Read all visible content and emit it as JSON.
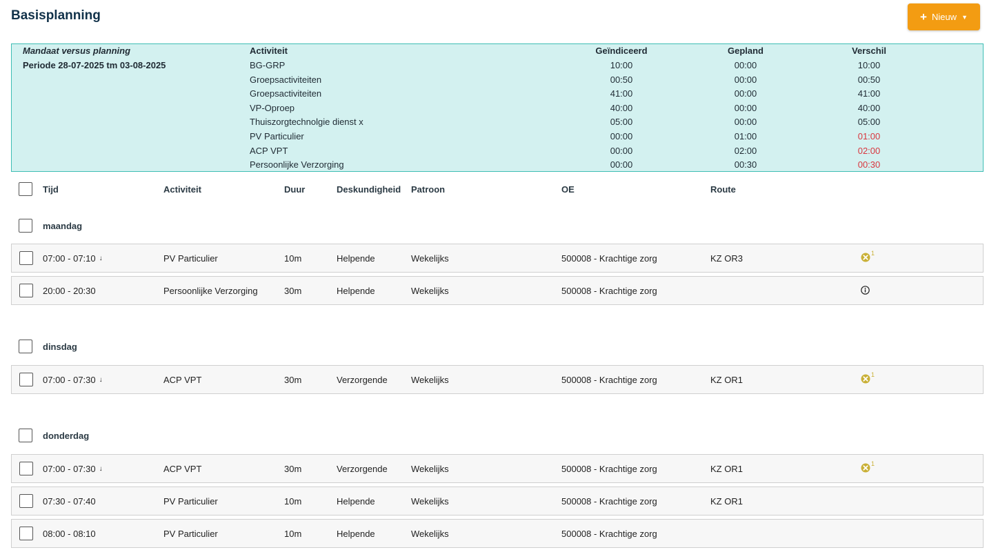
{
  "page": {
    "title": "Basisplanning"
  },
  "new_button": {
    "label": "Nieuw",
    "icon": "plus-icon",
    "caret": "caret-down-icon"
  },
  "summary": {
    "title": "Mandaat versus planning",
    "period": "Periode 28-07-2025 tm 03-08-2025",
    "headers": {
      "activity": "Activiteit",
      "indicated": "Geïndiceerd",
      "planned": "Gepland",
      "difference": "Verschil"
    },
    "rows": [
      {
        "activity": "BG-GRP",
        "indicated": "10:00",
        "planned": "00:00",
        "difference": "10:00",
        "negative": false
      },
      {
        "activity": "Groepsactiviteiten",
        "indicated": "00:50",
        "planned": "00:00",
        "difference": "00:50",
        "negative": false
      },
      {
        "activity": "Groepsactiviteiten",
        "indicated": "41:00",
        "planned": "00:00",
        "difference": "41:00",
        "negative": false
      },
      {
        "activity": "VP-Oproep",
        "indicated": "40:00",
        "planned": "00:00",
        "difference": "40:00",
        "negative": false
      },
      {
        "activity": "Thuiszorgtechnolgie dienst x",
        "indicated": "05:00",
        "planned": "00:00",
        "difference": "05:00",
        "negative": false
      },
      {
        "activity": "PV Particulier",
        "indicated": "00:00",
        "planned": "01:00",
        "difference": "01:00",
        "negative": true
      },
      {
        "activity": "ACP VPT",
        "indicated": "00:00",
        "planned": "02:00",
        "difference": "02:00",
        "negative": true
      },
      {
        "activity": "Persoonlijke Verzorging",
        "indicated": "00:00",
        "planned": "00:30",
        "difference": "00:30",
        "negative": true
      }
    ]
  },
  "table": {
    "headers": {
      "time": "Tijd",
      "activity": "Activiteit",
      "duration": "Duur",
      "expertise": "Deskundigheid",
      "pattern": "Patroon",
      "oe": "OE",
      "route": "Route"
    }
  },
  "days": [
    {
      "label": "maandag",
      "rows": [
        {
          "time": "07:00 - 07:10",
          "has_arrow": true,
          "activity": "PV Particulier",
          "duration": "10m",
          "expertise": "Helpende",
          "pattern": "Wekelijks",
          "oe": "500008 - Krachtige zorg",
          "route": "KZ OR3",
          "status": "warning",
          "status_count": "1"
        },
        {
          "time": "20:00 - 20:30",
          "has_arrow": false,
          "activity": "Persoonlijke Verzorging",
          "duration": "30m",
          "expertise": "Helpende",
          "pattern": "Wekelijks",
          "oe": "500008 - Krachtige zorg",
          "route": "",
          "status": "info",
          "status_count": ""
        }
      ]
    },
    {
      "label": "dinsdag",
      "rows": [
        {
          "time": "07:00 - 07:30",
          "has_arrow": true,
          "activity": "ACP VPT",
          "duration": "30m",
          "expertise": "Verzorgende",
          "pattern": "Wekelijks",
          "oe": "500008 - Krachtige zorg",
          "route": "KZ OR1",
          "status": "warning",
          "status_count": "1"
        }
      ]
    },
    {
      "label": "donderdag",
      "rows": [
        {
          "time": "07:00 - 07:30",
          "has_arrow": true,
          "activity": "ACP VPT",
          "duration": "30m",
          "expertise": "Verzorgende",
          "pattern": "Wekelijks",
          "oe": "500008 - Krachtige zorg",
          "route": "KZ OR1",
          "status": "warning",
          "status_count": "1"
        },
        {
          "time": "07:30 - 07:40",
          "has_arrow": false,
          "activity": "PV Particulier",
          "duration": "10m",
          "expertise": "Helpende",
          "pattern": "Wekelijks",
          "oe": "500008 - Krachtige zorg",
          "route": "KZ OR1",
          "status": "",
          "status_count": ""
        },
        {
          "time": "08:00 - 08:10",
          "has_arrow": false,
          "activity": "PV Particulier",
          "duration": "10m",
          "expertise": "Helpende",
          "pattern": "Wekelijks",
          "oe": "500008 - Krachtige zorg",
          "route": "",
          "status": "",
          "status_count": ""
        }
      ]
    }
  ],
  "colors": {
    "accent": "#f39c12",
    "summary_bg": "#d3f1f0",
    "summary_border": "#3dbdb4",
    "negative": "#d9363e",
    "warning": "#c9b036"
  }
}
